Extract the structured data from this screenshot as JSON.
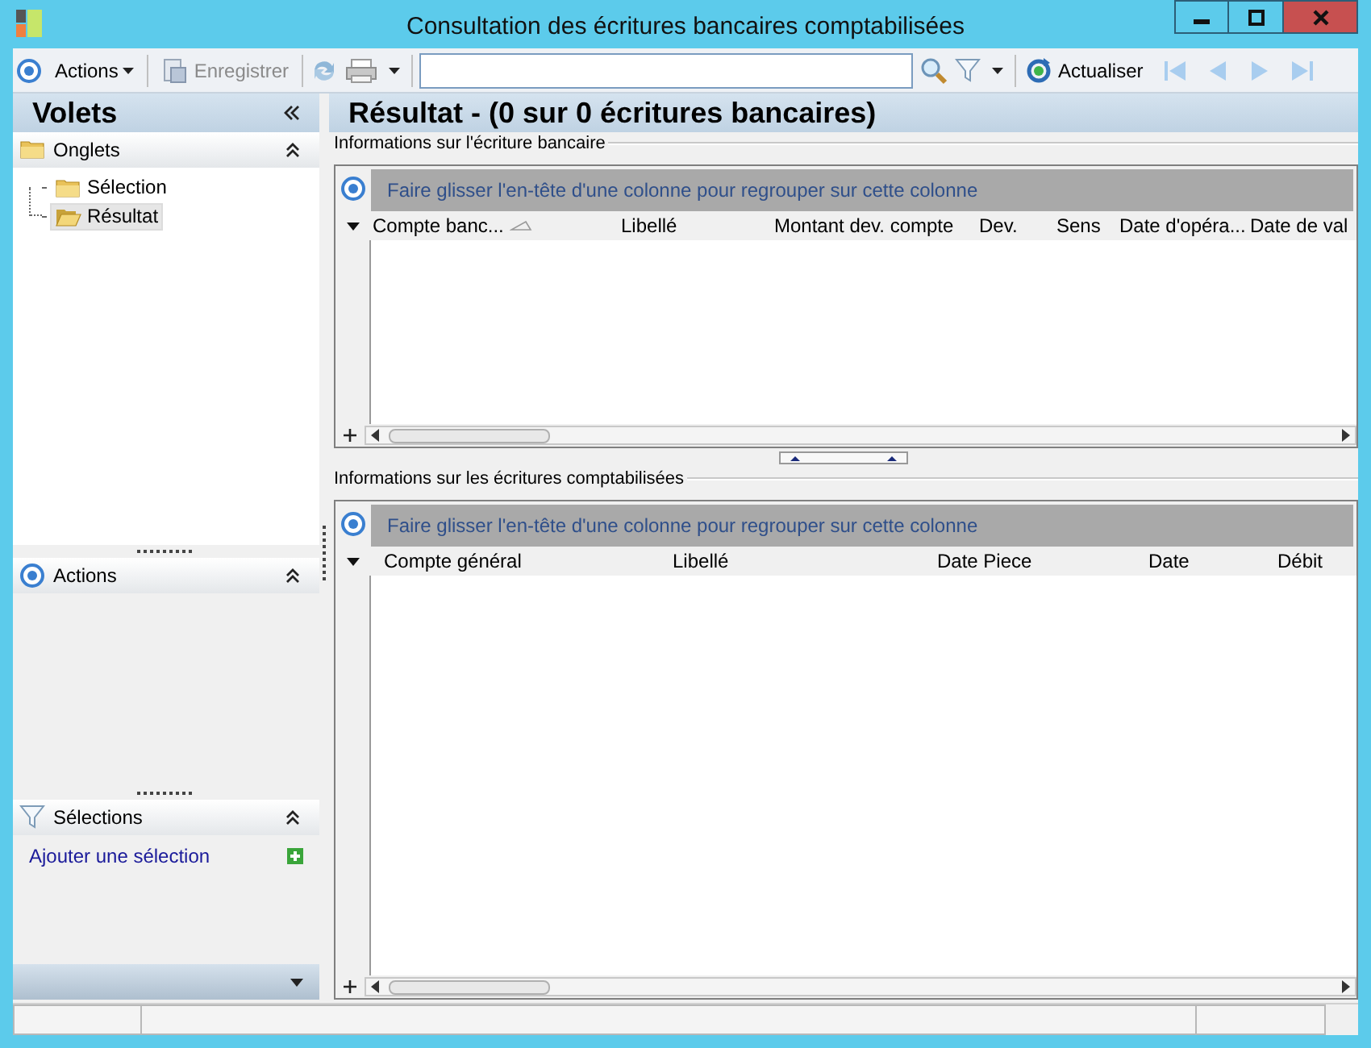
{
  "window": {
    "title": "Consultation des écritures bancaires comptabilisées"
  },
  "toolbar": {
    "actions": "Actions",
    "save": {
      "label": "Enregistrer",
      "disabled": true
    },
    "refresh": "Actualiser"
  },
  "left_pane": {
    "title": "Volets",
    "sections": [
      {
        "kind": "tree",
        "title": "Onglets",
        "expanded": true,
        "items": [
          {
            "label": "Sélection",
            "selected": false
          },
          {
            "label": "Résultat",
            "selected": true
          }
        ]
      },
      {
        "kind": "empty",
        "title": "Actions",
        "expanded": true
      },
      {
        "kind": "links",
        "title": "Sélections",
        "expanded": true,
        "links": [
          "Ajouter une sélection"
        ]
      }
    ]
  },
  "main": {
    "title": "Résultat - (0 sur 0 écritures bancaires)",
    "grids": [
      {
        "legend": "Informations sur l'écriture bancaire",
        "group_hint": "Faire glisser l'en-tête d'une colonne pour regrouper sur cette colonne",
        "columns": [
          {
            "label": "Compte banc...",
            "sorted": true
          },
          {
            "label": "Libellé",
            "sorted": false
          },
          {
            "label": "Montant dev. compte",
            "sorted": false
          },
          {
            "label": "Dev.",
            "sorted": false
          },
          {
            "label": "Sens",
            "sorted": false
          },
          {
            "label": "Date d'opéra...",
            "sorted": false
          },
          {
            "label": "Date de val",
            "sorted": false
          }
        ]
      },
      {
        "legend": "Informations sur les écritures comptabilisées",
        "group_hint": "Faire glisser l'en-tête d'une colonne pour regrouper sur cette colonne",
        "columns": [
          {
            "label": "Compte général",
            "sorted": false
          },
          {
            "label": "Libellé",
            "sorted": false
          },
          {
            "label": "Date Piece",
            "sorted": false
          },
          {
            "label": "Date",
            "sorted": false
          },
          {
            "label": "Débit",
            "sorted": false
          }
        ]
      }
    ]
  }
}
